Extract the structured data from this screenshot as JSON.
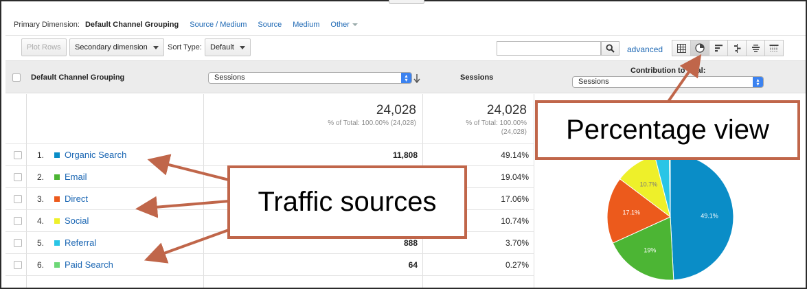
{
  "primary_dimension": {
    "label": "Primary Dimension:",
    "current": "Default Channel Grouping",
    "options": [
      "Source / Medium",
      "Source",
      "Medium"
    ],
    "other": "Other"
  },
  "toolbar": {
    "plot_rows": "Plot Rows",
    "secondary_dimension": "Secondary dimension",
    "sort_type_label": "Sort Type:",
    "sort_type_value": "Default",
    "search_value": "",
    "advanced": "advanced",
    "view_icons": [
      "grid-view-icon",
      "pie-view-icon",
      "performance-view-icon",
      "comparison-view-icon",
      "term-cloud-view-icon",
      "pivot-view-icon"
    ],
    "active_view": "pie-view-icon"
  },
  "table": {
    "dimension_header": "Default Channel Grouping",
    "metric_select": "Sessions",
    "sessions_header": "Sessions",
    "contribution_header": "Contribution to total:",
    "contribution_select": "Sessions",
    "totals": {
      "sessions": "24,028",
      "sessions_sub": "% of Total: 100.00% (24,028)",
      "sessions2": "24,028",
      "sessions2_sub_line1": "% of Total: 100.00%",
      "sessions2_sub_line2": "(24,028)"
    },
    "rows": [
      {
        "index": "1.",
        "name": "Organic Search",
        "sessions": "11,808",
        "percent": "49.14%",
        "color": "#0a8dc7"
      },
      {
        "index": "2.",
        "name": "Email",
        "sessions": "",
        "percent": "19.04%",
        "color": "#4cb534"
      },
      {
        "index": "3.",
        "name": "Direct",
        "sessions": "",
        "percent": "17.06%",
        "color": "#ec5a1c"
      },
      {
        "index": "4.",
        "name": "Social",
        "sessions": "",
        "percent": "10.74%",
        "color": "#eef02a"
      },
      {
        "index": "5.",
        "name": "Referral",
        "sessions": "888",
        "percent": "3.70%",
        "color": "#29c5e6"
      },
      {
        "index": "6.",
        "name": "Paid Search",
        "sessions": "64",
        "percent": "0.27%",
        "color": "#6cd776"
      }
    ]
  },
  "pie": {
    "slices": [
      {
        "name": "Organic Search",
        "value": 49.14,
        "label": "49.1%",
        "color": "#0a8dc7"
      },
      {
        "name": "Email",
        "value": 19.04,
        "label": "19%",
        "color": "#4cb534"
      },
      {
        "name": "Direct",
        "value": 17.06,
        "label": "17.1%",
        "color": "#ec5a1c"
      },
      {
        "name": "Social",
        "value": 10.74,
        "label": "10.7%",
        "color": "#eef02a"
      },
      {
        "name": "Referral",
        "value": 3.7,
        "label": "",
        "color": "#29c5e6"
      },
      {
        "name": "Paid Search",
        "value": 0.27,
        "label": "",
        "color": "#6cd776"
      }
    ]
  },
  "annotations": {
    "traffic_sources": "Traffic sources",
    "percentage_view": "Percentage view",
    "arrow_color": "#c0664a"
  }
}
